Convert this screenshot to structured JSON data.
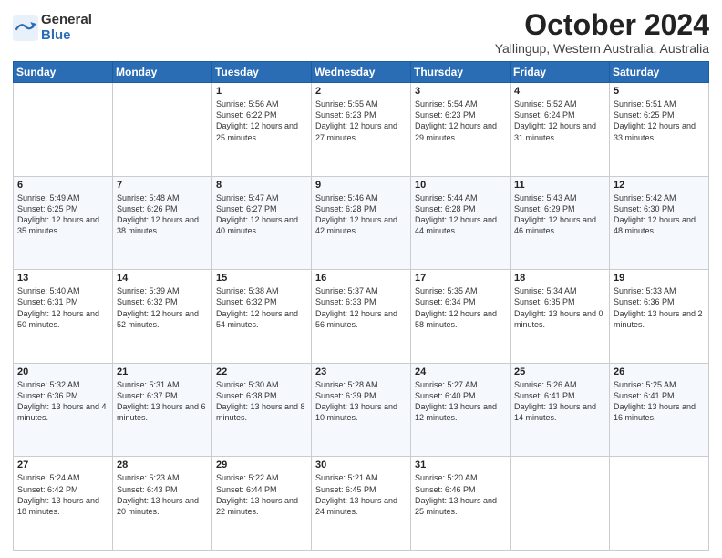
{
  "logo": {
    "general": "General",
    "blue": "Blue"
  },
  "title": {
    "month": "October 2024",
    "location": "Yallingup, Western Australia, Australia"
  },
  "days": [
    "Sunday",
    "Monday",
    "Tuesday",
    "Wednesday",
    "Thursday",
    "Friday",
    "Saturday"
  ],
  "weeks": [
    [
      {
        "day": "",
        "content": ""
      },
      {
        "day": "",
        "content": ""
      },
      {
        "day": "1",
        "sunrise": "5:56 AM",
        "sunset": "6:22 PM",
        "daylight": "12 hours and 25 minutes."
      },
      {
        "day": "2",
        "sunrise": "5:55 AM",
        "sunset": "6:23 PM",
        "daylight": "12 hours and 27 minutes."
      },
      {
        "day": "3",
        "sunrise": "5:54 AM",
        "sunset": "6:23 PM",
        "daylight": "12 hours and 29 minutes."
      },
      {
        "day": "4",
        "sunrise": "5:52 AM",
        "sunset": "6:24 PM",
        "daylight": "12 hours and 31 minutes."
      },
      {
        "day": "5",
        "sunrise": "5:51 AM",
        "sunset": "6:25 PM",
        "daylight": "12 hours and 33 minutes."
      }
    ],
    [
      {
        "day": "6",
        "sunrise": "5:49 AM",
        "sunset": "6:25 PM",
        "daylight": "12 hours and 35 minutes."
      },
      {
        "day": "7",
        "sunrise": "5:48 AM",
        "sunset": "6:26 PM",
        "daylight": "12 hours and 38 minutes."
      },
      {
        "day": "8",
        "sunrise": "5:47 AM",
        "sunset": "6:27 PM",
        "daylight": "12 hours and 40 minutes."
      },
      {
        "day": "9",
        "sunrise": "5:46 AM",
        "sunset": "6:28 PM",
        "daylight": "12 hours and 42 minutes."
      },
      {
        "day": "10",
        "sunrise": "5:44 AM",
        "sunset": "6:28 PM",
        "daylight": "12 hours and 44 minutes."
      },
      {
        "day": "11",
        "sunrise": "5:43 AM",
        "sunset": "6:29 PM",
        "daylight": "12 hours and 46 minutes."
      },
      {
        "day": "12",
        "sunrise": "5:42 AM",
        "sunset": "6:30 PM",
        "daylight": "12 hours and 48 minutes."
      }
    ],
    [
      {
        "day": "13",
        "sunrise": "5:40 AM",
        "sunset": "6:31 PM",
        "daylight": "12 hours and 50 minutes."
      },
      {
        "day": "14",
        "sunrise": "5:39 AM",
        "sunset": "6:32 PM",
        "daylight": "12 hours and 52 minutes."
      },
      {
        "day": "15",
        "sunrise": "5:38 AM",
        "sunset": "6:32 PM",
        "daylight": "12 hours and 54 minutes."
      },
      {
        "day": "16",
        "sunrise": "5:37 AM",
        "sunset": "6:33 PM",
        "daylight": "12 hours and 56 minutes."
      },
      {
        "day": "17",
        "sunrise": "5:35 AM",
        "sunset": "6:34 PM",
        "daylight": "12 hours and 58 minutes."
      },
      {
        "day": "18",
        "sunrise": "5:34 AM",
        "sunset": "6:35 PM",
        "daylight": "13 hours and 0 minutes."
      },
      {
        "day": "19",
        "sunrise": "5:33 AM",
        "sunset": "6:36 PM",
        "daylight": "13 hours and 2 minutes."
      }
    ],
    [
      {
        "day": "20",
        "sunrise": "5:32 AM",
        "sunset": "6:36 PM",
        "daylight": "13 hours and 4 minutes."
      },
      {
        "day": "21",
        "sunrise": "5:31 AM",
        "sunset": "6:37 PM",
        "daylight": "13 hours and 6 minutes."
      },
      {
        "day": "22",
        "sunrise": "5:30 AM",
        "sunset": "6:38 PM",
        "daylight": "13 hours and 8 minutes."
      },
      {
        "day": "23",
        "sunrise": "5:28 AM",
        "sunset": "6:39 PM",
        "daylight": "13 hours and 10 minutes."
      },
      {
        "day": "24",
        "sunrise": "5:27 AM",
        "sunset": "6:40 PM",
        "daylight": "13 hours and 12 minutes."
      },
      {
        "day": "25",
        "sunrise": "5:26 AM",
        "sunset": "6:41 PM",
        "daylight": "13 hours and 14 minutes."
      },
      {
        "day": "26",
        "sunrise": "5:25 AM",
        "sunset": "6:41 PM",
        "daylight": "13 hours and 16 minutes."
      }
    ],
    [
      {
        "day": "27",
        "sunrise": "5:24 AM",
        "sunset": "6:42 PM",
        "daylight": "13 hours and 18 minutes."
      },
      {
        "day": "28",
        "sunrise": "5:23 AM",
        "sunset": "6:43 PM",
        "daylight": "13 hours and 20 minutes."
      },
      {
        "day": "29",
        "sunrise": "5:22 AM",
        "sunset": "6:44 PM",
        "daylight": "13 hours and 22 minutes."
      },
      {
        "day": "30",
        "sunrise": "5:21 AM",
        "sunset": "6:45 PM",
        "daylight": "13 hours and 24 minutes."
      },
      {
        "day": "31",
        "sunrise": "5:20 AM",
        "sunset": "6:46 PM",
        "daylight": "13 hours and 25 minutes."
      },
      {
        "day": "",
        "content": ""
      },
      {
        "day": "",
        "content": ""
      }
    ]
  ]
}
